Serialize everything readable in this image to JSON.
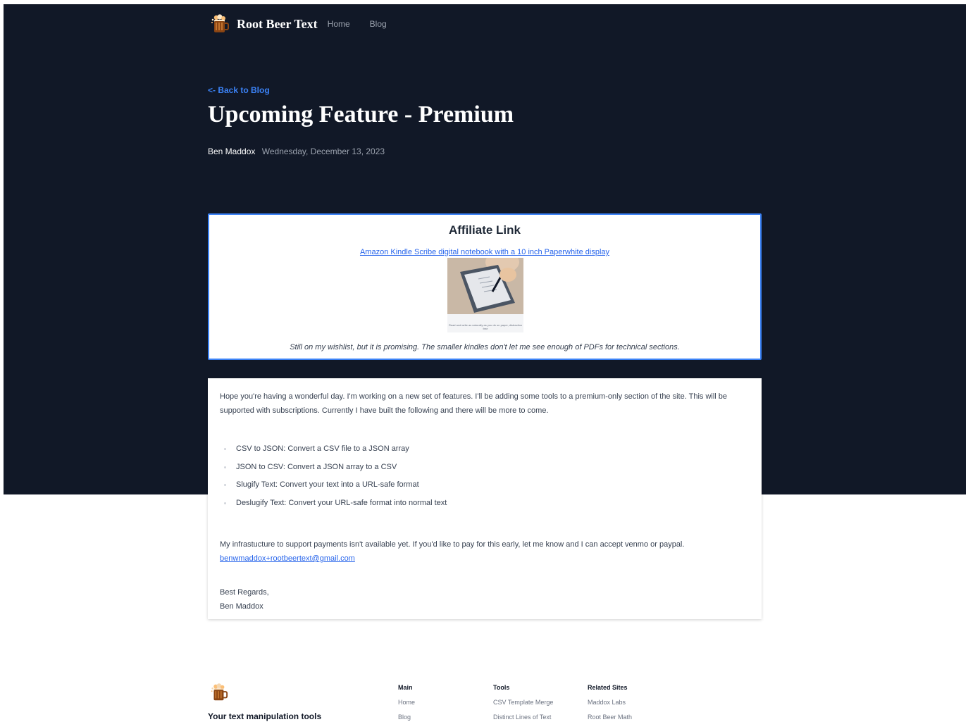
{
  "nav": {
    "brand": "Root Beer Text",
    "links": [
      "Home",
      "Blog"
    ]
  },
  "post": {
    "back_link": "<- Back to Blog",
    "title": "Upcoming Feature - Premium",
    "author": "Ben Maddox",
    "date": "Wednesday, December 13, 2023"
  },
  "affiliate": {
    "heading": "Affiliate Link",
    "link_text": "Amazon Kindle Scribe digital notebook with a 10 inch Paperwhite display",
    "image_caption": "Read and write as naturally as you do on paper, distraction free",
    "note": "Still on my wishlist, but it is promising. The smaller kindles don't let me see enough of PDFs for technical sections."
  },
  "content": {
    "intro": "Hope you're having a wonderful day. I'm working on a new set of features. I'll be adding some tools to a premium-only section of the site. This will be supported with subscriptions. Currently I have built the following and there will be more to come.",
    "features": [
      "CSV to JSON: Convert a CSV file to a JSON array",
      "JSON to CSV: Convert a JSON array to a CSV",
      "Slugify Text: Convert your text into a URL-safe format",
      "Deslugify Text: Convert your URL-safe format into normal text"
    ],
    "payments": "My infrastucture to support payments isn't available yet. If you'd like to pay for this early, let me know and I can accept venmo or paypal.",
    "email": "benwmaddox+rootbeertext@gmail.com",
    "closing": "Best Regards,",
    "signature": "Ben Maddox"
  },
  "footer": {
    "tagline": "Your text manipulation tools",
    "columns": [
      {
        "title": "Main",
        "links": [
          "Home",
          "Blog"
        ]
      },
      {
        "title": "Tools",
        "links": [
          "CSV Template Merge",
          "Distinct Lines of Text"
        ]
      },
      {
        "title": "Related Sites",
        "links": [
          "Maddox Labs",
          "Root Beer Math"
        ]
      }
    ]
  },
  "colors": {
    "hero_bg": "#111827",
    "accent": "#3b82f6",
    "link": "#2563eb"
  },
  "icons": [
    "root-beer-mug-icon"
  ]
}
